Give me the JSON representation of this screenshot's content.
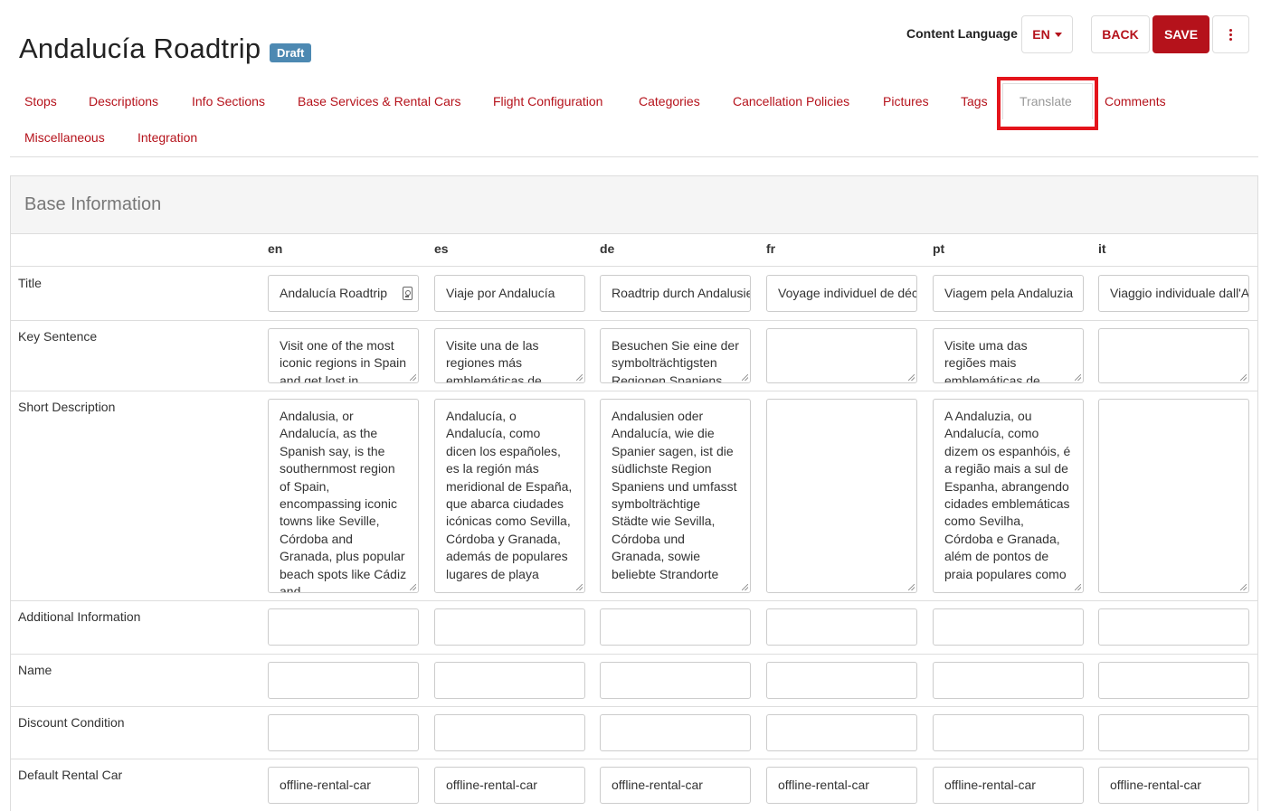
{
  "header": {
    "title": "Andalucía Roadtrip",
    "status_badge": "Draft",
    "content_language_label": "Content Language",
    "content_language_value": "EN",
    "back_label": "BACK",
    "save_label": "SAVE"
  },
  "tabs": [
    "Stops",
    "Descriptions",
    "Info Sections",
    "Base Services & Rental Cars",
    "Flight Configuration",
    "Categories",
    "Cancellation Policies",
    "Pictures",
    "Tags",
    "Translate",
    "Comments",
    "Miscellaneous",
    "Integration"
  ],
  "active_tab": "Translate",
  "panel": {
    "title": "Base Information",
    "languages": [
      "en",
      "es",
      "de",
      "fr",
      "pt",
      "it"
    ],
    "rows": [
      {
        "label": "Title",
        "type": "input",
        "values": [
          "Andalucía Roadtrip",
          "Viaje por Andalucía",
          "Roadtrip durch Andalusien",
          "Voyage individuel de découverte",
          "Viagem pela Andaluzia",
          "Viaggio individuale dall'Andalusia"
        ]
      },
      {
        "label": "Key Sentence",
        "type": "area",
        "values": [
          "Visit one of the most iconic regions in Spain and get lost in",
          "Visite una de las regiones más emblemáticas de",
          "Besuchen Sie eine der symbolträchtigsten Regionen Spaniens",
          "",
          "Visite uma das regiões mais emblemáticas de",
          ""
        ]
      },
      {
        "label": "Short Description",
        "type": "area",
        "values": [
          "Andalusia, or Andalucía, as the Spanish say, is the southernmost region of Spain, encompassing iconic towns like Seville, Córdoba and Granada, plus popular beach spots like Cádiz and",
          "Andalucía, o Andalucía, como dicen los españoles, es la región más meridional de España, que abarca ciudades icónicas como Sevilla, Córdoba y Granada, además de populares lugares de playa",
          "Andalusien oder Andalucía, wie die Spanier sagen, ist die südlichste Region Spaniens und umfasst symbolträchtige Städte wie Sevilla, Córdoba und Granada, sowie beliebte Strandorte",
          "",
          "A Andaluzia, ou Andalucía, como dizem os espanhóis, é a região mais a sul de Espanha, abrangendo cidades emblemáticas como Sevilha, Córdoba e Granada, além de pontos de praia populares como",
          ""
        ]
      },
      {
        "label": "Additional Information",
        "type": "input",
        "values": [
          "",
          "",
          "",
          "",
          "",
          ""
        ]
      },
      {
        "label": "Name",
        "type": "input",
        "values": [
          "",
          "",
          "",
          "",
          "",
          ""
        ]
      },
      {
        "label": "Discount Condition",
        "type": "input",
        "values": [
          "",
          "",
          "",
          "",
          "",
          ""
        ]
      },
      {
        "label": "Default Rental Car",
        "type": "input",
        "values": [
          "offline-rental-car",
          "offline-rental-car",
          "offline-rental-car",
          "offline-rental-car",
          "offline-rental-car",
          "offline-rental-car"
        ]
      }
    ]
  },
  "colors": {
    "accent": "#b5121b",
    "badge": "#4d89b2",
    "highlight": "#e4141b"
  }
}
